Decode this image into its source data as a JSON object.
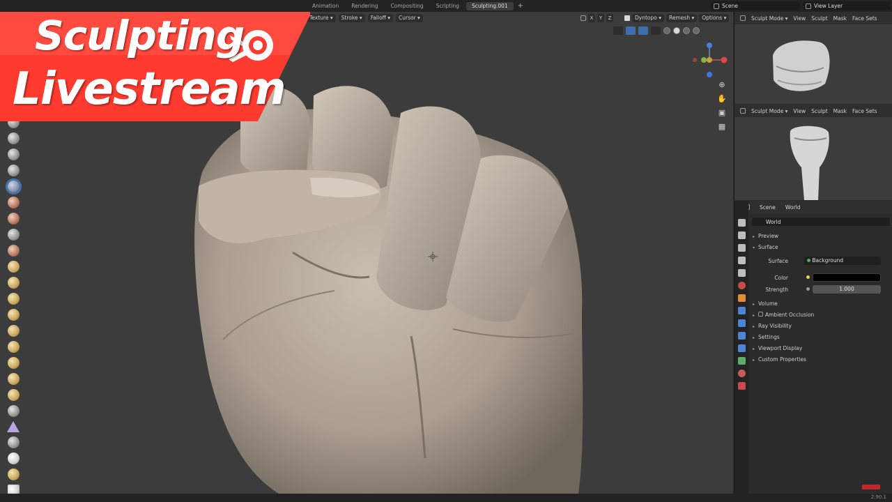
{
  "banner": {
    "line1": "Sculpting",
    "line2": "Livestream",
    "bg_color": "#ff3b30"
  },
  "workspace_tabs": [
    "Animation",
    "Rendering",
    "Compositing",
    "Scripting",
    "Sculpting.001"
  ],
  "workspace_active": "Sculpting.001",
  "scene": {
    "label": "Scene"
  },
  "view_layer": {
    "label": "View Layer"
  },
  "viewport": {
    "menus": [
      "Texture",
      "Stroke",
      "Falloff",
      "Cursor"
    ],
    "axes": [
      "X",
      "Y",
      "Z"
    ],
    "dyntopo": "Dyntopo",
    "remesh": "Remesh",
    "options": "Options",
    "nav_icons": [
      "zoom-icon",
      "hand-icon",
      "camera-icon",
      "grid-icon"
    ]
  },
  "mini_viewports": [
    {
      "mode": "Sculpt Mode",
      "menus": [
        "View",
        "Sculpt",
        "Mask",
        "Face Sets"
      ]
    },
    {
      "mode": "Sculpt Mode",
      "menus": [
        "View",
        "Sculpt",
        "Mask",
        "Face Sets"
      ]
    }
  ],
  "properties": {
    "breadcrumb_scene": "Scene",
    "breadcrumb_world": "World",
    "world_name": "World",
    "sections": {
      "preview": "Preview",
      "surface": "Surface",
      "volume": "Volume",
      "ambient_occlusion": "Ambient Occlusion",
      "ray_visibility": "Ray Visibility",
      "settings": "Settings",
      "viewport_display": "Viewport Display",
      "custom_properties": "Custom Properties"
    },
    "surface_label": "Surface",
    "surface_value": "Background",
    "color_label": "Color",
    "color_value": "#000000",
    "strength_label": "Strength",
    "strength_value": "1.000"
  },
  "version": "2.90.1"
}
